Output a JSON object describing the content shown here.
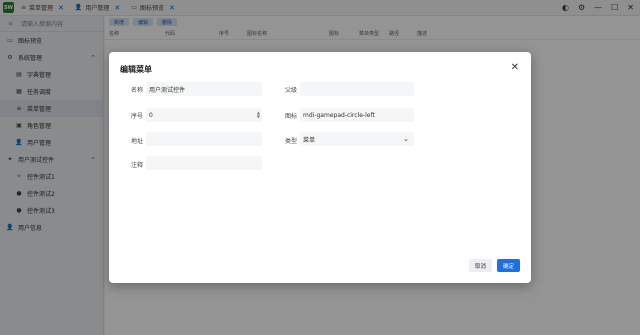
{
  "app": {
    "logo_text": "SW"
  },
  "tabs": [
    {
      "icon": "menu-icon",
      "icon_glyph": "≡",
      "label": "菜单管理",
      "close": "✕"
    },
    {
      "icon": "user-icon",
      "icon_glyph": "👤",
      "label": "用户管理",
      "close": "✕"
    },
    {
      "icon": "image-icon",
      "icon_glyph": "▭",
      "label": "图标预览",
      "close": "✕"
    }
  ],
  "window_controls": {
    "theme": "◐",
    "settings": "⚙",
    "minimize": "—",
    "maximize": "☐",
    "close": "✕"
  },
  "sidebar": {
    "collapse_glyph": "≡",
    "search_placeholder": "请输入搜索内容",
    "items": [
      {
        "label": "图标预览",
        "icon_glyph": "▭",
        "level": 0
      },
      {
        "label": "系统管理",
        "icon_glyph": "⚙",
        "level": 0,
        "expanded": true,
        "chevron": "⌃"
      },
      {
        "label": "字典管理",
        "icon_glyph": "▤",
        "level": 1
      },
      {
        "label": "任务调度",
        "icon_glyph": "▦",
        "level": 1
      },
      {
        "label": "菜单管理",
        "icon_glyph": "≡",
        "level": 1,
        "active": true
      },
      {
        "label": "角色管理",
        "icon_glyph": "▣",
        "level": 1
      },
      {
        "label": "用户管理",
        "icon_glyph": "👤",
        "level": 1
      },
      {
        "label": "用户测试控件",
        "icon_glyph": "✦",
        "level": 0,
        "expanded": true,
        "chevron": "⌃"
      },
      {
        "label": "控件测试1",
        "icon_glyph": "✧",
        "level": 1
      },
      {
        "label": "控件测试2",
        "icon_glyph": "●",
        "level": 1
      },
      {
        "label": "控件测试3",
        "icon_glyph": "●",
        "level": 1
      },
      {
        "label": "用户信息",
        "icon_glyph": "👤",
        "level": 0
      }
    ]
  },
  "content": {
    "toolbar": [
      "新增",
      "编辑",
      "删除"
    ],
    "columns": [
      "名称",
      "代码",
      "序号",
      "图标名称",
      "图标",
      "菜单类型",
      "路径",
      "描述"
    ]
  },
  "dialog": {
    "title": "编辑菜单",
    "close_glyph": "✕",
    "fields": {
      "name": {
        "label": "名称",
        "value": "用户测试控件"
      },
      "parent": {
        "label": "父级",
        "value": ""
      },
      "order": {
        "label": "序号",
        "value": "0"
      },
      "icon": {
        "label": "图标",
        "value": "mdi-gamepad-circle-left"
      },
      "address": {
        "label": "地址",
        "value": ""
      },
      "type": {
        "label": "类型",
        "value": "菜单"
      },
      "remark": {
        "label": "注释",
        "value": ""
      }
    },
    "cancel_label": "取消",
    "ok_label": "确定"
  }
}
